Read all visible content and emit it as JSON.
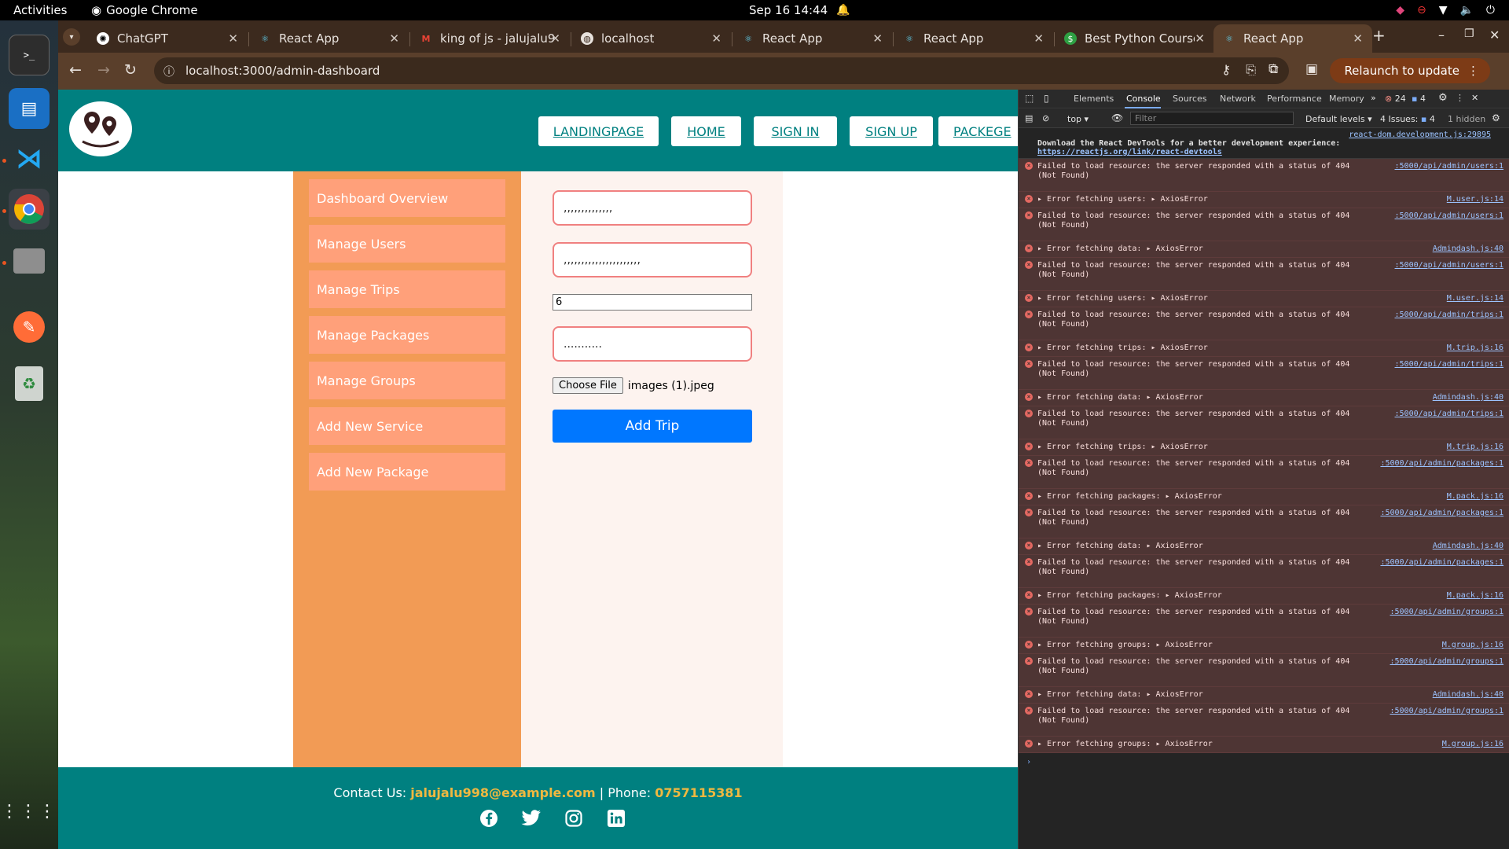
{
  "system": {
    "activities": "Activities",
    "app_name": "Google Chrome",
    "clock": "Sep 16  14:44"
  },
  "tabs": [
    {
      "title": "ChatGPT",
      "favicon": "chatgpt-icon"
    },
    {
      "title": "React App",
      "favicon": "react-icon"
    },
    {
      "title": "king of js - jalujalu9",
      "favicon": "gmail-icon"
    },
    {
      "title": "localhost",
      "favicon": "globe-icon"
    },
    {
      "title": "React App",
      "favicon": "react-icon"
    },
    {
      "title": "React App",
      "favicon": "react-icon"
    },
    {
      "title": "Best Python Course",
      "favicon": "python-course-icon"
    },
    {
      "title": "React App",
      "favicon": "react-icon",
      "active": true
    }
  ],
  "browser": {
    "url": "localhost:3000/admin-dashboard",
    "relaunch_label": "Relaunch to update"
  },
  "site": {
    "nav": [
      "LANDINGPAGE",
      "HOME",
      "SIGN IN",
      "SIGN UP",
      "PACKEGE"
    ],
    "sidebar": [
      "Dashboard Overview",
      "Manage Users",
      "Manage Trips",
      "Manage Packages",
      "Manage Groups",
      "Add New Service",
      "Add New Package"
    ],
    "form": {
      "field1_value": ",,,,,,,,,,,,,,",
      "field2_value": ",,,,,,,,,,,,,,,,,,,,,,",
      "number_value": "6",
      "field4_value": "...........",
      "choose_file_label": "Choose File",
      "file_name": "images (1).jpeg",
      "submit_label": "Add Trip"
    },
    "footer": {
      "contact_prefix": "Contact Us:",
      "email": "jalujalu998@example.com",
      "phone_prefix": "| Phone:",
      "phone": "0757115381"
    }
  },
  "devtools": {
    "tabs": [
      "Elements",
      "Console",
      "Sources",
      "Network",
      "Performance",
      "Memory"
    ],
    "error_count": "24",
    "message_count": "4",
    "context": "top",
    "filter_placeholder": "Filter",
    "levels": "Default levels",
    "issues": "4 Issues:",
    "issues_count": "4",
    "hidden": "1 hidden",
    "info_source": "react-dom.development.js:29895",
    "info_text": "Download the React DevTools for a better development experience:",
    "info_link": "https://reactjs.org/link/react-devtools",
    "messages": [
      {
        "text": "Failed to load resource: the server responded with a status of 404 (Not Found)",
        "src": ":5000/api/admin/users:1"
      },
      {
        "text": "▸ Error fetching users:  ▸ AxiosError",
        "src": "M.user.js:14"
      },
      {
        "text": "Failed to load resource: the server responded with a status of 404 (Not Found)",
        "src": ":5000/api/admin/users:1"
      },
      {
        "text": "▸ Error fetching data:  ▸ AxiosError",
        "src": "Admindash.js:40"
      },
      {
        "text": "Failed to load resource: the server responded with a status of 404 (Not Found)",
        "src": ":5000/api/admin/users:1"
      },
      {
        "text": "▸ Error fetching users:  ▸ AxiosError",
        "src": "M.user.js:14"
      },
      {
        "text": "Failed to load resource: the server responded with a status of 404 (Not Found)",
        "src": ":5000/api/admin/trips:1"
      },
      {
        "text": "▸ Error fetching trips:  ▸ AxiosError",
        "src": "M.trip.js:16"
      },
      {
        "text": "Failed to load resource: the server responded with a status of 404 (Not Found)",
        "src": ":5000/api/admin/trips:1"
      },
      {
        "text": "▸ Error fetching data:  ▸ AxiosError",
        "src": "Admindash.js:40"
      },
      {
        "text": "Failed to load resource: the server responded with a status of 404 (Not Found)",
        "src": ":5000/api/admin/trips:1"
      },
      {
        "text": "▸ Error fetching trips:  ▸ AxiosError",
        "src": "M.trip.js:16"
      },
      {
        "text": "Failed to load resource: the server responded with a status of 404 (Not Found)",
        "src": ":5000/api/admin/packages:1"
      },
      {
        "text": "▸ Error fetching packages:  ▸ AxiosError",
        "src": "M.pack.js:16"
      },
      {
        "text": "Failed to load resource: the server responded with a status of 404 (Not Found)",
        "src": ":5000/api/admin/packages:1"
      },
      {
        "text": "▸ Error fetching data:  ▸ AxiosError",
        "src": "Admindash.js:40"
      },
      {
        "text": "Failed to load resource: the server responded with a status of 404 (Not Found)",
        "src": ":5000/api/admin/packages:1"
      },
      {
        "text": "▸ Error fetching packages:  ▸ AxiosError",
        "src": "M.pack.js:16"
      },
      {
        "text": "Failed to load resource: the server responded with a status of 404 (Not Found)",
        "src": ":5000/api/admin/groups:1"
      },
      {
        "text": "▸ Error fetching groups:  ▸ AxiosError",
        "src": "M.group.js:16"
      },
      {
        "text": "Failed to load resource: the server responded with a status of 404 (Not Found)",
        "src": ":5000/api/admin/groups:1"
      },
      {
        "text": "▸ Error fetching data:  ▸ AxiosError",
        "src": "Admindash.js:40"
      },
      {
        "text": "Failed to load resource: the server responded with a status of 404 (Not Found)",
        "src": ":5000/api/admin/groups:1"
      },
      {
        "text": "▸ Error fetching groups:  ▸ AxiosError",
        "src": "M.group.js:16"
      }
    ]
  },
  "colors": {
    "teal": "#008080",
    "sidebar": "#f29b55",
    "sidebar_item": "#ffa07a",
    "button_blue": "#0077ff",
    "footer_highlight": "#f0b840"
  }
}
